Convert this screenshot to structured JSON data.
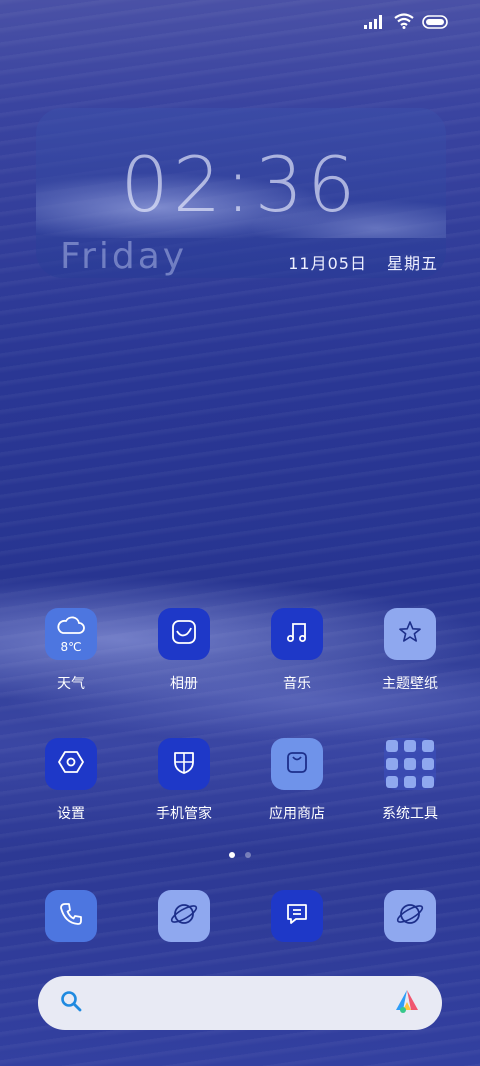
{
  "status": {
    "icons": [
      "signal-icon",
      "wifi-icon",
      "battery-icon"
    ]
  },
  "clock": {
    "time": "02:36",
    "day": "Friday",
    "date": "11月05日",
    "weekday": "星期五"
  },
  "apps_row1": [
    {
      "label": "天气",
      "icon": "cloud-icon",
      "temp": "8℃"
    },
    {
      "label": "相册",
      "icon": "gallery-icon"
    },
    {
      "label": "音乐",
      "icon": "music-icon"
    },
    {
      "label": "主题壁纸",
      "icon": "theme-star-icon"
    }
  ],
  "apps_row2": [
    {
      "label": "设置",
      "icon": "settings-icon"
    },
    {
      "label": "手机管家",
      "icon": "shield-icon"
    },
    {
      "label": "应用商店",
      "icon": "store-bag-icon"
    },
    {
      "label": "系统工具",
      "icon": "folder-icon"
    }
  ],
  "dock": [
    {
      "icon": "phone-icon"
    },
    {
      "icon": "browser-icon"
    },
    {
      "icon": "messages-icon"
    },
    {
      "icon": "browser-icon"
    }
  ],
  "pager": {
    "pages": 2,
    "current": 1
  },
  "search": {
    "icon": "search-icon",
    "assistant_icon": "app-vault-icon"
  },
  "colors": {
    "tile_dark": "#1e38c8",
    "tile_mid": "#4d76e0",
    "tile_light": "#8fa8ef"
  }
}
